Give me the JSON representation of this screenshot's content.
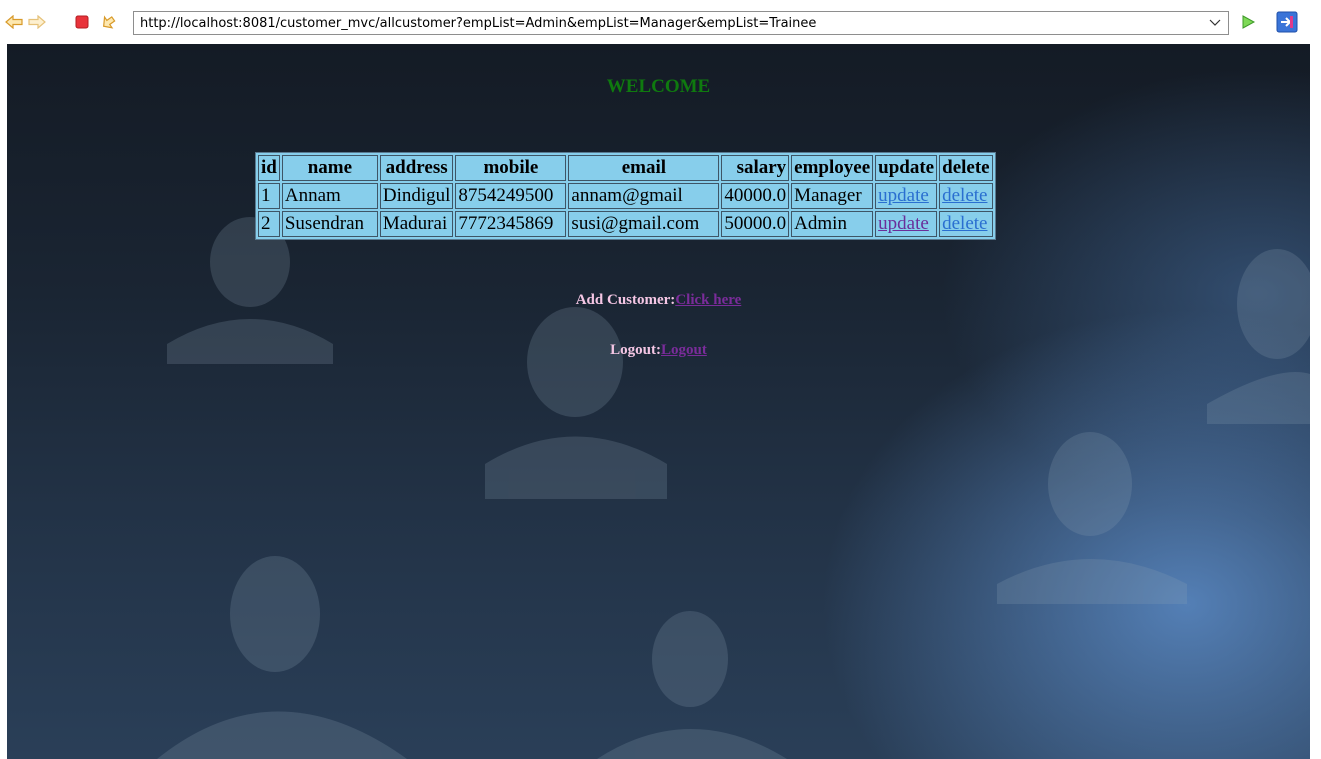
{
  "browser": {
    "url": "http://localhost:8081/customer_mvc/allcustomer?empList=Admin&empList=Manager&empList=Trainee",
    "toolbar_icons": [
      "back-arrow-icon",
      "forward-arrow-icon",
      "stop-icon",
      "refresh-icon",
      "dropdown-chevron-icon",
      "go-play-icon",
      "open-external-icon"
    ]
  },
  "page": {
    "title": "WELCOME",
    "table": {
      "headers": [
        "id",
        "name",
        "address",
        "mobile",
        "email",
        "salary",
        "employee",
        "update",
        "delete"
      ],
      "rows": [
        {
          "id": "1",
          "name": "Annam",
          "address": "Dindigul",
          "mobile": "8754249500",
          "email": "annam@gmail",
          "salary": "40000.0",
          "employee": "Manager",
          "update": "update",
          "delete": "delete"
        },
        {
          "id": "2",
          "name": "Susendran",
          "address": "Madurai",
          "mobile": "7772345869",
          "email": "susi@gmail.com",
          "salary": "50000.0",
          "employee": "Admin",
          "update": "update",
          "delete": "delete"
        }
      ]
    },
    "add_customer": {
      "label": "Add Customer:",
      "link": "Click here"
    },
    "logout": {
      "label": "Logout:",
      "link": "Logout"
    }
  },
  "colors": {
    "welcome": "#0f7a0f",
    "table_bg": "#87ceeb",
    "link": "#2a6fd0",
    "visited_link": "#6a2e9a",
    "label_text": "#f4c6e4"
  }
}
